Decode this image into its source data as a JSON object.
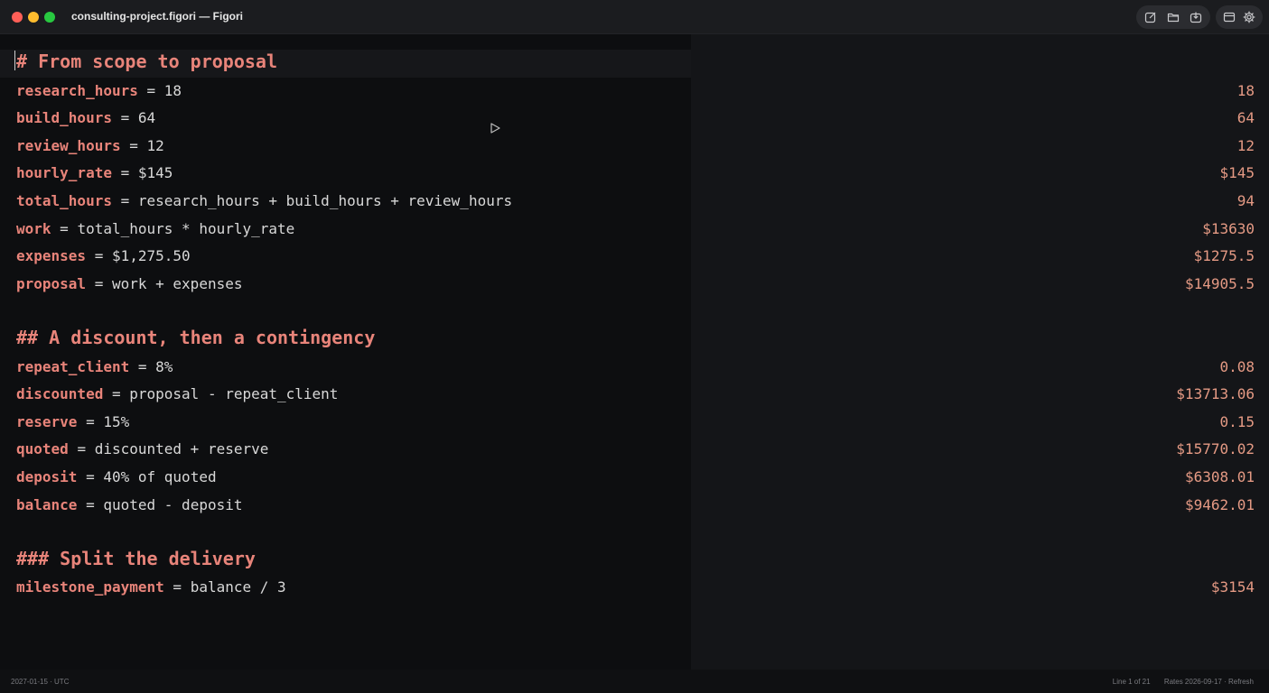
{
  "window": {
    "title": "consulting-project.figori — Figori"
  },
  "toolbar": {
    "buttons": [
      {
        "icon": "new-note-icon"
      },
      {
        "icon": "folder-icon"
      },
      {
        "icon": "export-icon"
      },
      {
        "icon": "toggle-panel-icon"
      },
      {
        "icon": "settings-gear-icon"
      }
    ]
  },
  "document": {
    "heading1": "# From scope to proposal",
    "heading2": "## A discount, then a contingency",
    "heading3": "### Split the delivery",
    "lines": [
      {
        "name": "research_hours",
        "expr": "18",
        "result": "18"
      },
      {
        "name": "build_hours",
        "expr": "64",
        "result": "64"
      },
      {
        "name": "review_hours",
        "expr": "12",
        "result": "12"
      },
      {
        "name": "hourly_rate",
        "expr": "$145",
        "result": "$145"
      },
      {
        "name": "total_hours",
        "expr": "research_hours + build_hours + review_hours",
        "result": "94"
      },
      {
        "name": "work",
        "expr": "total_hours * hourly_rate",
        "result": "$13630"
      },
      {
        "name": "expenses",
        "expr": "$1,275.50",
        "result": "$1275.5"
      },
      {
        "name": "proposal",
        "expr": "work + expenses",
        "result": "$14905.5"
      },
      {
        "name": "repeat_client",
        "expr": "8%",
        "result": "0.08"
      },
      {
        "name": "discounted",
        "expr": "proposal - repeat_client",
        "result": "$13713.06"
      },
      {
        "name": "reserve",
        "expr": "15%",
        "result": "0.15"
      },
      {
        "name": "quoted",
        "expr": "discounted + reserve",
        "result": "$15770.02"
      },
      {
        "name": "deposit",
        "expr": "40% of quoted",
        "result": "$6308.01"
      },
      {
        "name": "balance",
        "expr": "quoted - deposit",
        "result": "$9462.01"
      },
      {
        "name": "milestone_payment",
        "expr": "balance / 3",
        "result": "$3154"
      }
    ],
    "operator": "="
  },
  "status": {
    "date": "2027-01-15 · UTC",
    "position": "Line 1 of 21",
    "rates": "Rates 2026-09-17 ·",
    "refresh": "Refresh"
  },
  "colors": {
    "variable": "#e8847a",
    "result": "#e59a84",
    "text": "#d8d8d8",
    "background": "#0d0e10"
  }
}
